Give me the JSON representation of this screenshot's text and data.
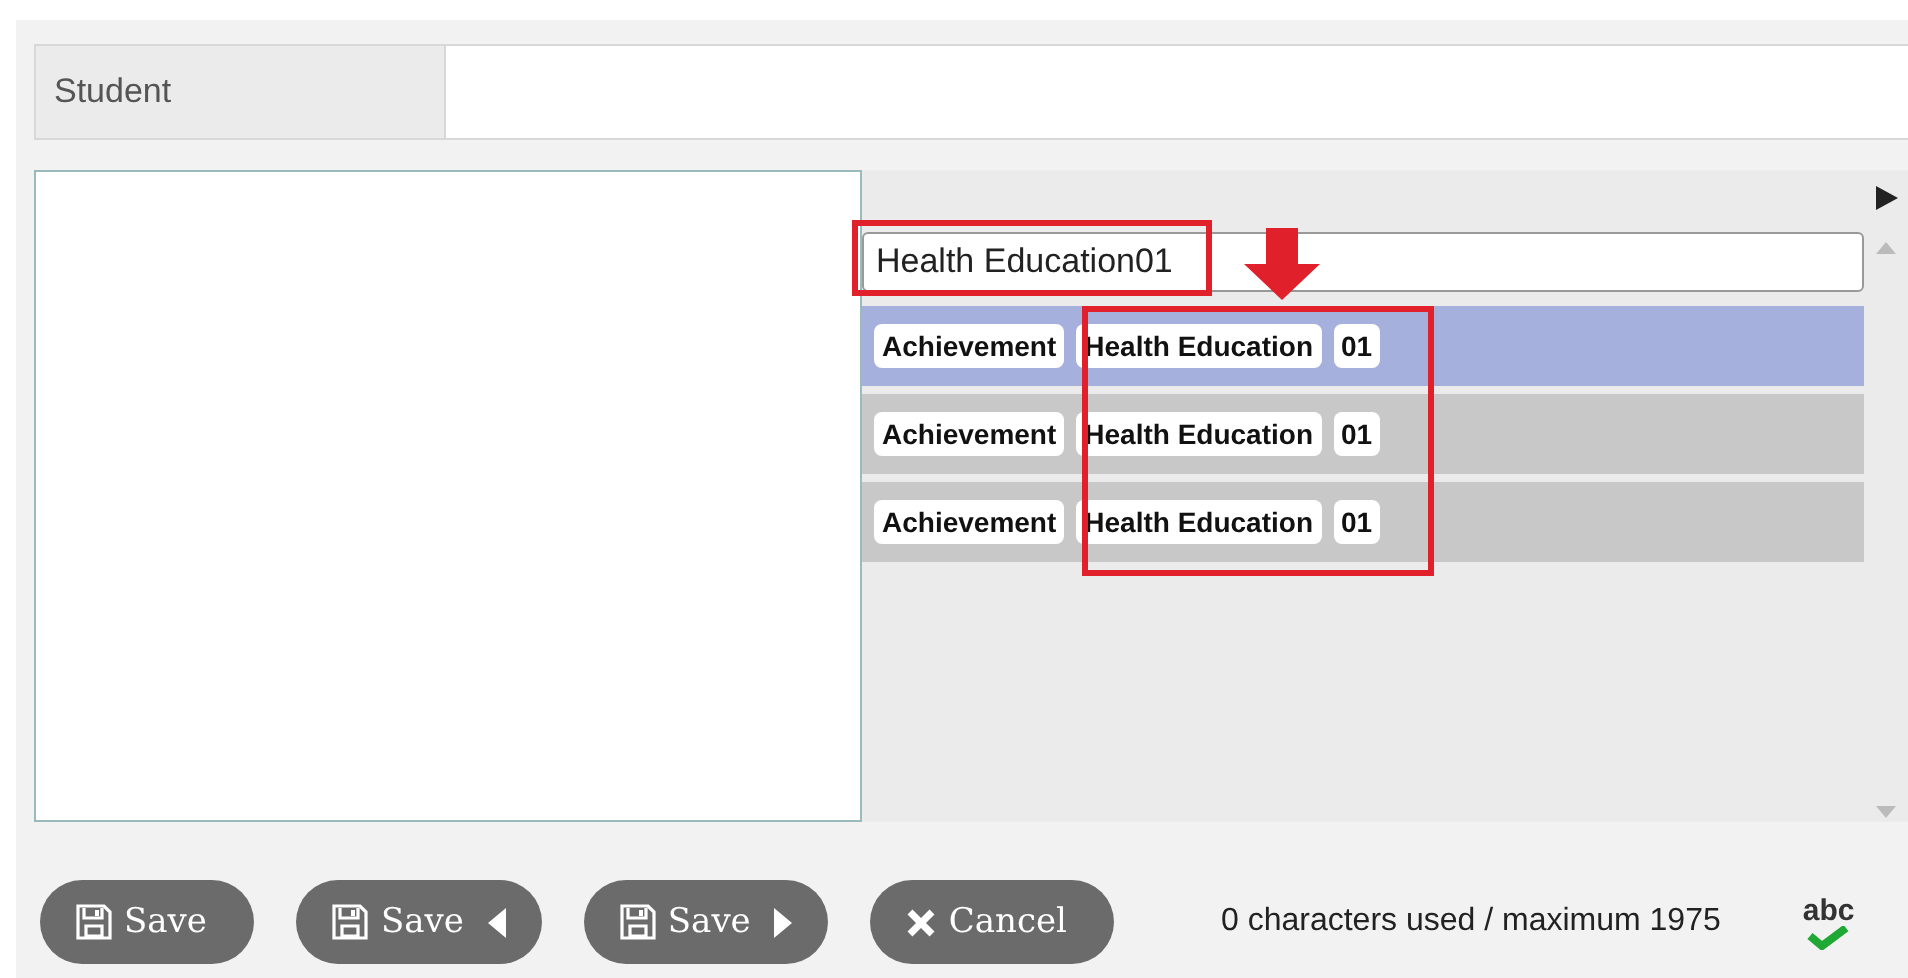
{
  "student_field": {
    "label": "Student"
  },
  "suggest_field": {
    "value": "Health Education01"
  },
  "suggestions": [
    {
      "category": "Achievement",
      "name": "Health Education",
      "code": "01",
      "selected": true
    },
    {
      "category": "Achievement",
      "name": "Health Education",
      "code": "01",
      "selected": false
    },
    {
      "category": "Achievement",
      "name": "Health Education",
      "code": "01",
      "selected": false
    }
  ],
  "buttons": [
    {
      "label": "Save",
      "kind": "save"
    },
    {
      "label": "Save",
      "kind": "save_prev"
    },
    {
      "label": "Save",
      "kind": "save_next"
    },
    {
      "label": "Cancel",
      "kind": "cancel"
    }
  ],
  "char_count": "0 characters used / maximum 1975",
  "spellcheck": {
    "label": "abc"
  }
}
